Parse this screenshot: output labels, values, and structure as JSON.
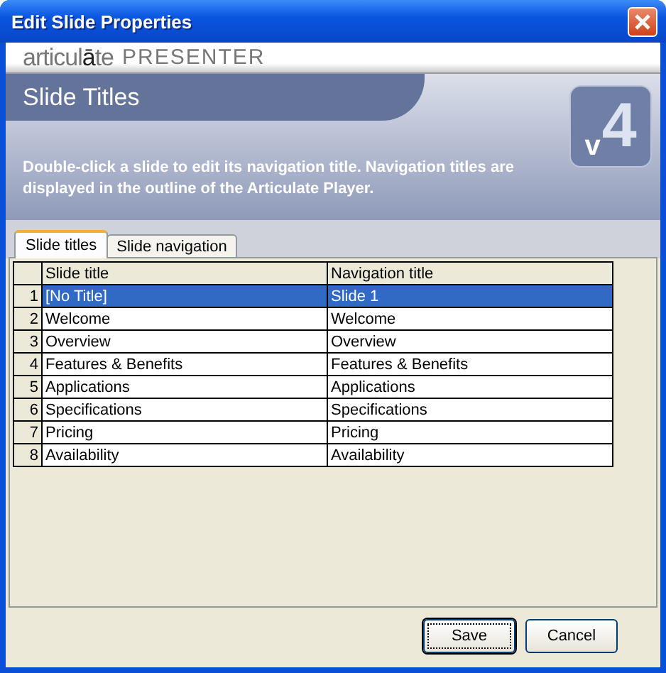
{
  "window": {
    "title": "Edit Slide Properties"
  },
  "banner": {
    "brand_prefix": "articul",
    "brand_accent": "ā",
    "brand_suffix": "te",
    "product": "PRESENTER"
  },
  "header": {
    "title": "Slide Titles",
    "description": "Double-click a slide to edit its navigation title.  Navigation titles are displayed in the outline of the Articulate Player.",
    "badge_number": "4",
    "badge_letter": "v"
  },
  "tabs": [
    {
      "label": "Slide titles",
      "selected": true
    },
    {
      "label": "Slide navigation",
      "selected": false
    }
  ],
  "table": {
    "columns": [
      "Slide title",
      "Navigation title"
    ],
    "rows": [
      {
        "number": "1",
        "slide_title": "[No Title]",
        "navigation_title": "Slide 1",
        "selected": true
      },
      {
        "number": "2",
        "slide_title": "Welcome",
        "navigation_title": "Welcome",
        "selected": false
      },
      {
        "number": "3",
        "slide_title": "Overview",
        "navigation_title": "Overview",
        "selected": false
      },
      {
        "number": "4",
        "slide_title": "Features & Benefits",
        "navigation_title": "Features & Benefits",
        "selected": false
      },
      {
        "number": "5",
        "slide_title": "Applications",
        "navigation_title": "Applications",
        "selected": false
      },
      {
        "number": "6",
        "slide_title": "Specifications",
        "navigation_title": "Specifications",
        "selected": false
      },
      {
        "number": "7",
        "slide_title": "Pricing",
        "navigation_title": "Pricing",
        "selected": false
      },
      {
        "number": "8",
        "slide_title": "Availability",
        "navigation_title": "Availability",
        "selected": false
      }
    ]
  },
  "buttons": [
    {
      "label": "Save",
      "default": true
    },
    {
      "label": "Cancel",
      "default": false
    }
  ]
}
